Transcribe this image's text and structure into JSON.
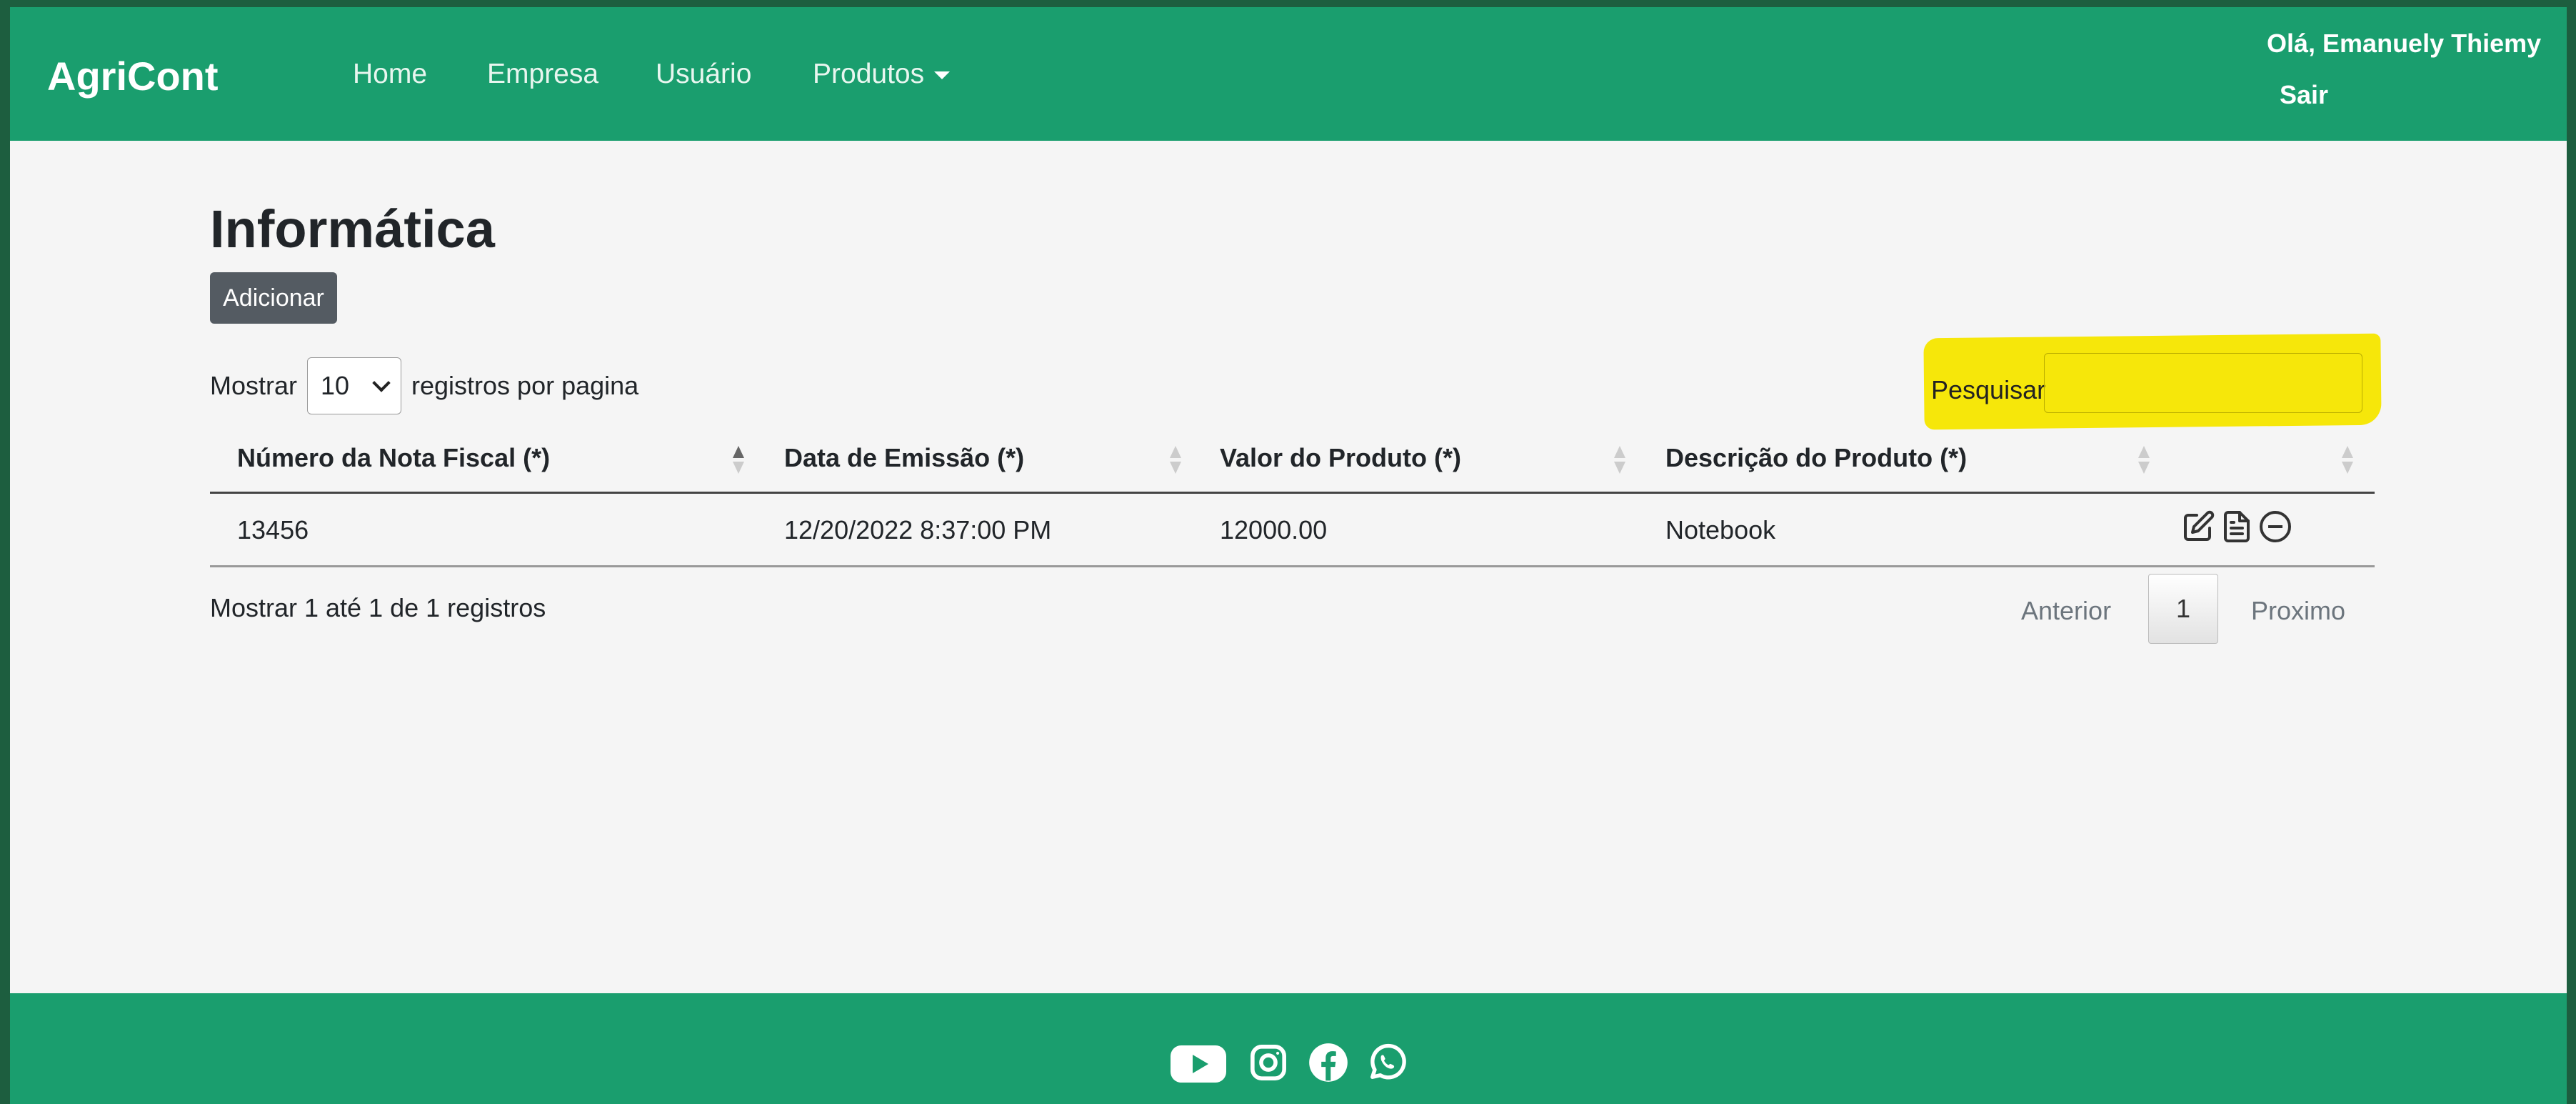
{
  "app": {
    "brand": "AgriCont"
  },
  "nav": {
    "items": [
      {
        "label": "Home"
      },
      {
        "label": "Empresa"
      },
      {
        "label": "Usuário"
      },
      {
        "label": "Produtos"
      }
    ],
    "user_greeting": "Olá, Emanuely Thiemy",
    "logout": "Sair"
  },
  "page": {
    "title": "Informática",
    "add_button": "Adicionar",
    "length_prefix": "Mostrar",
    "length_value": "10",
    "length_suffix": "registros por pagina",
    "search_label": "Pesquisar",
    "search_value": ""
  },
  "table": {
    "headers": [
      "Número da Nota Fiscal (*)",
      "Data de Emissão (*)",
      "Valor do Produto (*)",
      "Descrição do Produto (*)",
      ""
    ],
    "rows": [
      [
        "13456",
        "12/20/2022 8:37:00 PM",
        "12000.00",
        "Notebook"
      ]
    ],
    "row_actions": [
      "edit-icon",
      "document-icon",
      "remove-icon"
    ]
  },
  "pagination": {
    "info": "Mostrar 1 até 1 de 1 registros",
    "previous": "Anterior",
    "current_page": "1",
    "next": "Proximo"
  },
  "footer": {
    "social_icons": [
      "youtube-icon",
      "instagram-icon",
      "facebook-icon",
      "whatsapp-icon"
    ]
  },
  "colors": {
    "brand_green": "#1a9e6e",
    "outer_frame": "#1d5e3f",
    "highlight": "#f6e70a",
    "button_gray": "#545b62"
  }
}
